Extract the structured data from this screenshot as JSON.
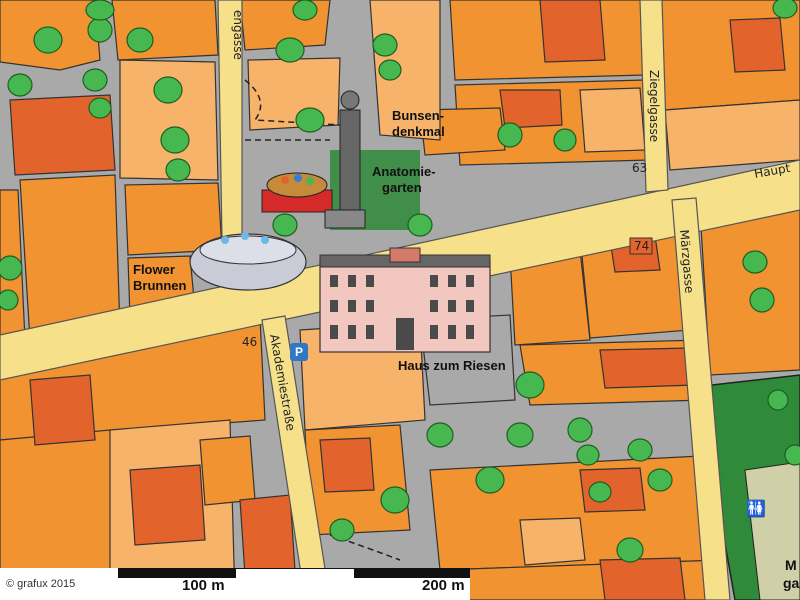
{
  "map": {
    "labels": {
      "bunsen": [
        "Bunsen-",
        "denkmal"
      ],
      "anatomie": [
        "Anatomie-",
        "garten"
      ],
      "flower": [
        "Flower",
        "Brunnen"
      ],
      "haus": "Haus zum Riesen",
      "streets": {
        "gasse_top": "engasse",
        "ziegelgasse": "Ziegelgasse",
        "maerzgasse": "Märzgasse",
        "akademiestrasse": "Akademiestraße",
        "haupt": "Haupt",
        "right_edge": [
          "M",
          "ga"
        ]
      },
      "numbers": {
        "n63": "63",
        "n74": "74",
        "n46": "46"
      }
    },
    "colors": {
      "background": "#a9a9a9",
      "street": "#f6e08a",
      "building_orange": "#f19330",
      "building_light": "#f7b36a",
      "building_dark": "#e2642c",
      "green_area": "#2f8a3a",
      "tree": "#46b84f"
    },
    "icons": {
      "parking": "parking-icon",
      "wc": "toilet-icon",
      "statue": "statue-icon",
      "fountain": "fountain-icon",
      "flower_basket": "flower-basket-icon",
      "palace": "palace-building-icon"
    },
    "parking_label": "P",
    "wc_label": "🚻"
  },
  "scalebar": {
    "label_100": "100 m",
    "label_200": "200 m"
  },
  "copyright": "© grafux 2015"
}
